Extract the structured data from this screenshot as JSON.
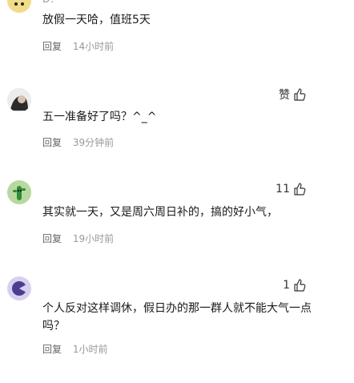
{
  "comments": [
    {
      "name": "D.",
      "text": "放假一天哈，值班5天",
      "reply_label": "回复",
      "time": "14小时前",
      "like": ""
    },
    {
      "name": "",
      "text": "五一准备好了吗？^_^",
      "reply_label": "回复",
      "time": "39分钟前",
      "like": "赞"
    },
    {
      "name": "",
      "text": "其实就一天，又是周六周日补的，搞的好小气，",
      "reply_label": "回复",
      "time": "19小时前",
      "like": "11"
    },
    {
      "name": "",
      "text": "个人反对这样调休，假日办的那一群人就不能大气一点吗？",
      "reply_label": "回复",
      "time": "1小时前",
      "like": "1"
    }
  ],
  "colors": {
    "muted": "#999999",
    "text": "#1a1a1a"
  },
  "icons": [
    "thumbs-up-icon"
  ]
}
